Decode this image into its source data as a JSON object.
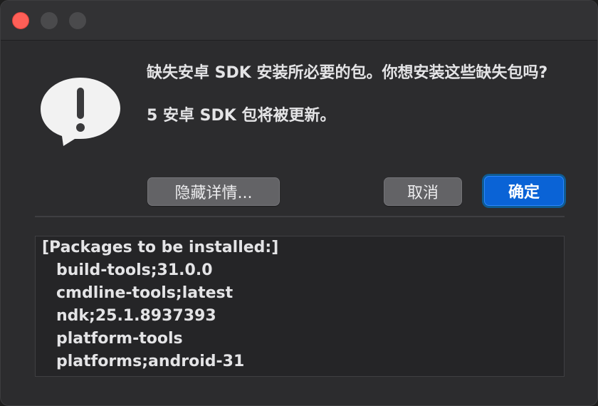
{
  "dialog": {
    "message_line1": "缺失安卓 SDK 安装所必要的包。你想安装这些缺失包吗?",
    "message_line2": "5 安卓 SDK 包将被更新。",
    "icon": "alert-exclamation-icon"
  },
  "buttons": {
    "details_label": "隐藏详情...",
    "cancel_label": "取消",
    "ok_label": "确定"
  },
  "details": {
    "header": "[Packages to be installed:]",
    "packages": [
      "build-tools;31.0.0",
      "cmdline-tools;latest",
      "ndk;25.1.8937393",
      "platform-tools",
      "platforms;android-31"
    ]
  },
  "colors": {
    "accent": "#0a63d6",
    "close": "#ff5f57"
  }
}
